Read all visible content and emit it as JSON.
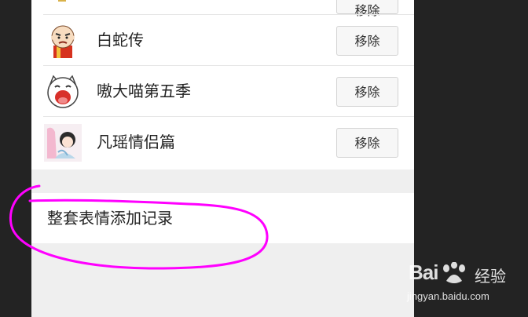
{
  "sticker_list": {
    "remove_label": "移除",
    "items": [
      {
        "title": "",
        "icon": "sticker-partial-icon"
      },
      {
        "title": "白蛇传",
        "icon": "bald-monk-sticker-icon"
      },
      {
        "title": "嗷大喵第五季",
        "icon": "laughing-cat-sticker-icon"
      },
      {
        "title": "凡瑶情侣篇",
        "icon": "couple-sticker-icon"
      }
    ]
  },
  "record_section": {
    "label": "整套表情添加记录"
  },
  "annotation": {
    "color": "#ff00ff"
  },
  "watermark": {
    "brand": "Bai",
    "cn": "经验",
    "url": "jingyan.baidu.com"
  }
}
